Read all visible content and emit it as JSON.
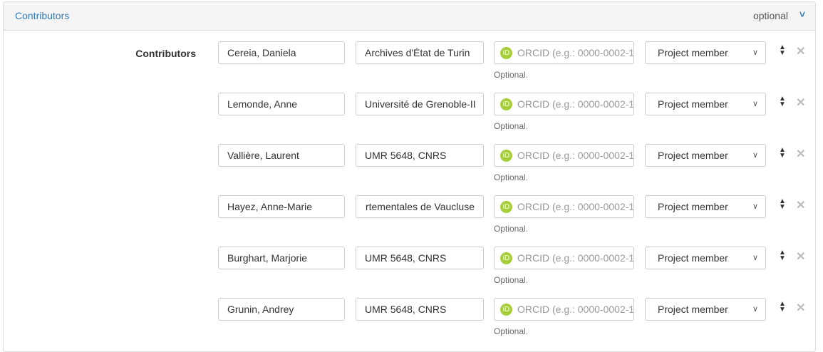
{
  "panel": {
    "title": "Contributors",
    "optional_label": "optional"
  },
  "field_label": "Contributors",
  "orcid_placeholder": "ORCID (e.g.: 0000-0002-1",
  "help": "Optional.",
  "contributors": [
    {
      "name": "Cereia, Daniela",
      "affiliation": "Archives d'État de Turin",
      "role": "Project member"
    },
    {
      "name": "Lemonde, Anne",
      "affiliation": "Université de Grenoble-II",
      "role": "Project member"
    },
    {
      "name": "Vallière, Laurent",
      "affiliation": "UMR 5648, CNRS",
      "role": "Project member"
    },
    {
      "name": "Hayez, Anne-Marie",
      "affiliation": "rtementales de Vaucluse",
      "role": "Project member"
    },
    {
      "name": "Burghart, Marjorie",
      "affiliation": "UMR 5648, CNRS",
      "role": "Project member"
    },
    {
      "name": "Grunin, Andrey",
      "affiliation": "UMR 5648, CNRS",
      "role": "Project member"
    }
  ]
}
